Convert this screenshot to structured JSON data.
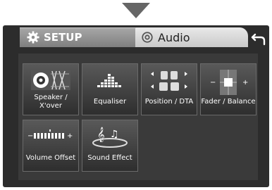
{
  "header": {
    "setup_tab_label": "SETUP",
    "audio_tab_label": "Audio"
  },
  "tiles": [
    {
      "label_line1": "Speaker /",
      "label_line2": "X'over"
    },
    {
      "label": "Equaliser"
    },
    {
      "label": "Position / DTA"
    },
    {
      "label": "Fader / Balance"
    },
    {
      "label": "Volume Offset"
    },
    {
      "label": "Sound Effect"
    }
  ]
}
